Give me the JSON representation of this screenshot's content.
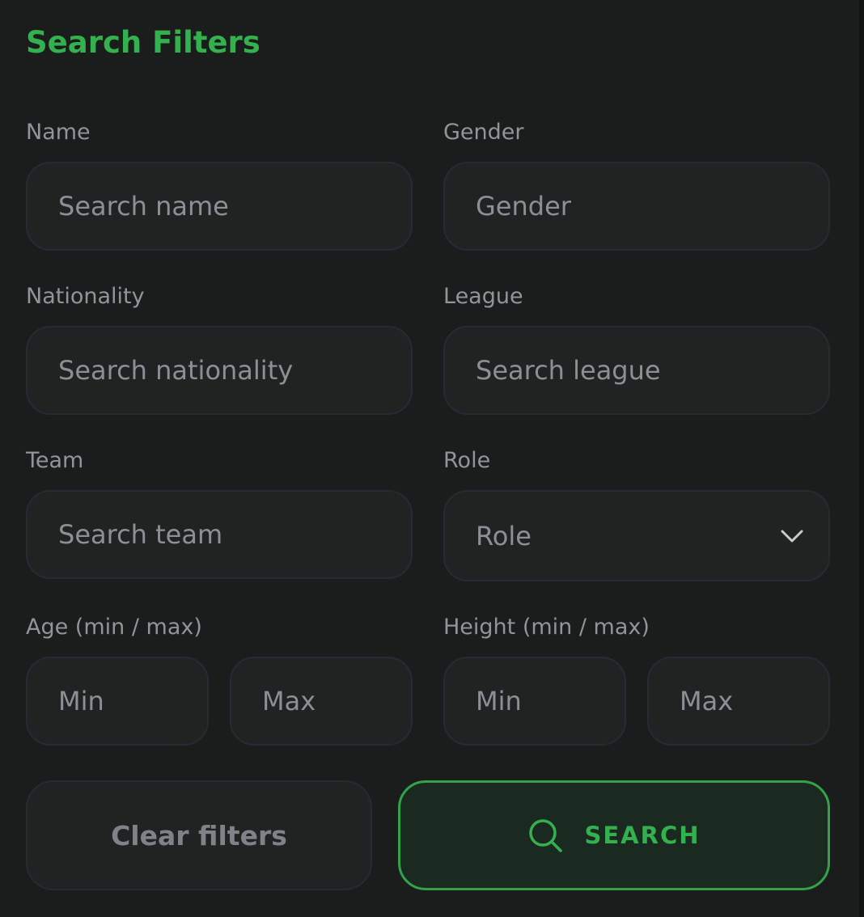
{
  "panel": {
    "title": "Search Filters"
  },
  "fields": {
    "name": {
      "label": "Name",
      "placeholder": "Search name"
    },
    "gender": {
      "label": "Gender",
      "placeholder": "Gender"
    },
    "nationality": {
      "label": "Nationality",
      "placeholder": "Search nationality"
    },
    "league": {
      "label": "League",
      "placeholder": "Search league"
    },
    "team": {
      "label": "Team",
      "placeholder": "Search team"
    },
    "role": {
      "label": "Role",
      "selected": "Role"
    },
    "age": {
      "label": "Age (min / max)",
      "min_placeholder": "Min",
      "max_placeholder": "Max"
    },
    "height": {
      "label": "Height (min / max)",
      "min_placeholder": "Min",
      "max_placeholder": "Max"
    }
  },
  "actions": {
    "clear_label": "Clear filters",
    "search_label": "SEARCH"
  },
  "icons": {
    "role_dropdown": "chevron-down-icon",
    "search": "search-icon"
  },
  "colors": {
    "accent": "#34b14f",
    "background": "#1b1d1c",
    "field_background": "#212322",
    "field_border": "#232c35",
    "label": "#8f959b"
  }
}
